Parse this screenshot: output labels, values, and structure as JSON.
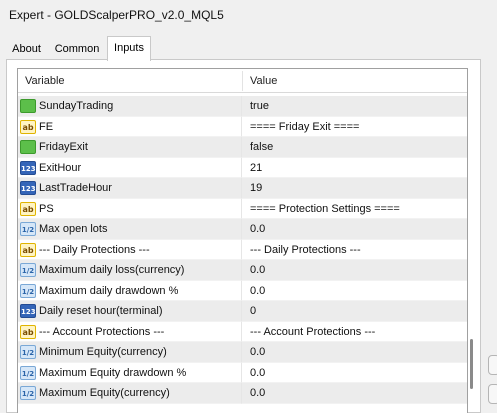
{
  "window": {
    "title": "Expert - GOLDScalperPRO_v2.0_MQL5"
  },
  "tabs": [
    {
      "label": "About"
    },
    {
      "label": "Common"
    },
    {
      "label": "Inputs"
    }
  ],
  "table": {
    "headers": {
      "variable": "Variable",
      "value": "Value"
    },
    "rows": [
      {
        "icon": "bool",
        "icon_text": "",
        "variable": "SundayTrading",
        "value": "true"
      },
      {
        "icon": "ab",
        "icon_text": "ab",
        "variable": "FE",
        "value": "==== Friday Exit ===="
      },
      {
        "icon": "bool",
        "icon_text": "",
        "variable": "FridayExit",
        "value": "false"
      },
      {
        "icon": "int",
        "icon_text": "123",
        "variable": "ExitHour",
        "value": "21"
      },
      {
        "icon": "int",
        "icon_text": "123",
        "variable": "LastTradeHour",
        "value": "19"
      },
      {
        "icon": "ab",
        "icon_text": "ab",
        "variable": "PS",
        "value": "==== Protection Settings ===="
      },
      {
        "icon": "dbl",
        "icon_text": "1/2",
        "variable": "Max open lots",
        "value": "0.0"
      },
      {
        "icon": "ab",
        "icon_text": "ab",
        "variable": "--- Daily Protections ---",
        "value": "--- Daily Protections ---"
      },
      {
        "icon": "dbl",
        "icon_text": "1/2",
        "variable": "Maximum daily loss(currency)",
        "value": "0.0"
      },
      {
        "icon": "dbl",
        "icon_text": "1/2",
        "variable": "Maximum daily drawdown %",
        "value": "0.0"
      },
      {
        "icon": "int",
        "icon_text": "123",
        "variable": "Daily reset hour(terminal)",
        "value": "0"
      },
      {
        "icon": "ab",
        "icon_text": "ab",
        "variable": "--- Account Protections ---",
        "value": "--- Account Protections ---"
      },
      {
        "icon": "dbl",
        "icon_text": "1/2",
        "variable": "Minimum Equity(currency)",
        "value": "0.0"
      },
      {
        "icon": "dbl",
        "icon_text": "1/2",
        "variable": "Maximum Equity drawdown %",
        "value": "0.0"
      },
      {
        "icon": "dbl",
        "icon_text": "1/2",
        "variable": "Maximum Equity(currency)",
        "value": "0.0"
      }
    ]
  }
}
